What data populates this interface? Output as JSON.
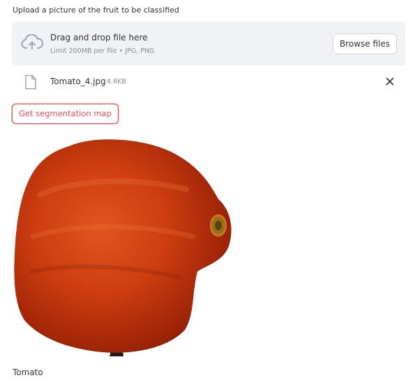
{
  "uploader": {
    "label": "Upload a picture of the fruit to be classified",
    "title": "Drag and drop file here",
    "limit": "Limit 200MB per file • JPG, PNG",
    "browse_label": "Browse files"
  },
  "file": {
    "name": "Tomato_4.jpg",
    "size": "4.8KB"
  },
  "segmentation_button_label": "Get segmentation map",
  "result_label": "Tomato",
  "icons": {
    "upload": "cloud-upload-icon",
    "file": "file-icon",
    "remove": "close-icon"
  },
  "colors": {
    "accent": "#ff4b4b",
    "dropzone_bg": "#f0f2f6",
    "text": "#31333f",
    "muted": "#8a8d97",
    "icon": "#a3a8b8"
  }
}
